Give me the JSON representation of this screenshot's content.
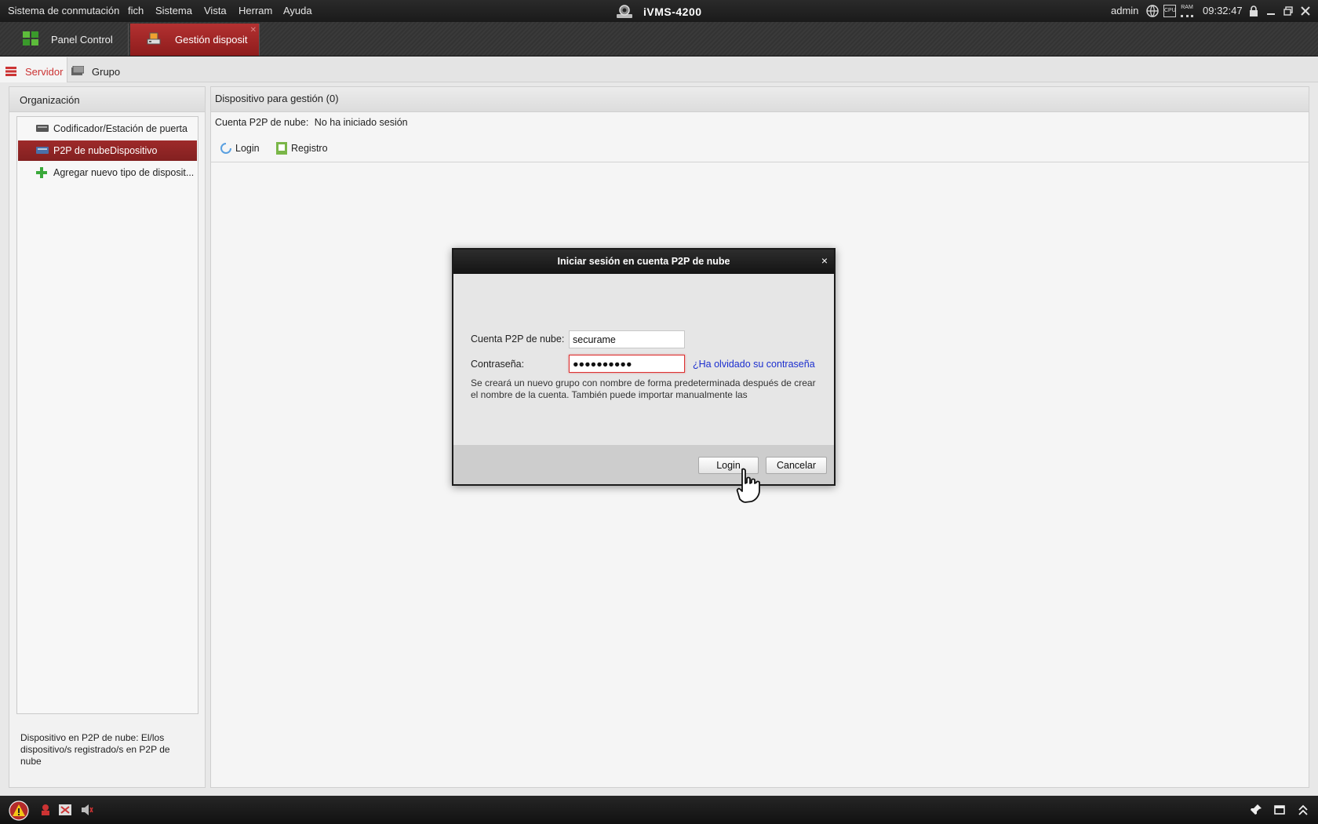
{
  "menubar": {
    "items": [
      "Sistema de conmutación",
      "fich",
      "Sistema",
      "Vista",
      "Herram",
      "Ayuda"
    ],
    "app_title": "iVMS-4200",
    "user": "admin",
    "time": "09:32:47",
    "cpu_label": "CPU",
    "ram_label": "RAM"
  },
  "module_tabs": [
    {
      "label": "Panel Control",
      "icon": "control-panel-icon",
      "active": false
    },
    {
      "label": "Gestión disposit",
      "icon": "device-management-icon",
      "active": true
    }
  ],
  "sub_tabs": [
    {
      "label": "Servidor",
      "icon": "server-icon",
      "active": true
    },
    {
      "label": "Grupo",
      "icon": "group-icon",
      "active": false
    }
  ],
  "left_panel": {
    "title": "Organización",
    "items": [
      {
        "label": "Codificador/Estación de puerta",
        "icon": "encoder-icon",
        "selected": false
      },
      {
        "label": "P2P de nubeDispositivo",
        "icon": "cloud-device-icon",
        "selected": true
      },
      {
        "label": "Agregar nuevo tipo de disposit...",
        "icon": "add-icon",
        "selected": false
      }
    ],
    "description": "Dispositivo en P2P de nube: El/los dispositivo/s registrado/s en P2P de nube"
  },
  "main_panel": {
    "title": "Dispositivo para gestión (0)",
    "cloud_account_label": "Cuenta P2P de nube:",
    "cloud_account_status": "No ha iniciado sesión",
    "toolbar": {
      "login_label": "Login",
      "register_label": "Registro"
    }
  },
  "modal": {
    "title": "Iniciar sesión en cuenta P2P de nube",
    "close_label": "×",
    "account_label": "Cuenta P2P de nube:",
    "account_value": "securame",
    "password_label": "Contraseña:",
    "password_value": "●●●●●●●●●●",
    "forgot_link": "¿Ha olvidado su contraseña",
    "info_text": "Se creará un nuevo grupo con nombre de forma predeterminada después de crear el nombre de la cuenta. También puede importar manualmente las",
    "login_button": "Login",
    "cancel_button": "Cancelar"
  },
  "colors": {
    "accent": "#b33131",
    "link": "#1c2fcf",
    "titlebar": "#1a1a1a"
  }
}
